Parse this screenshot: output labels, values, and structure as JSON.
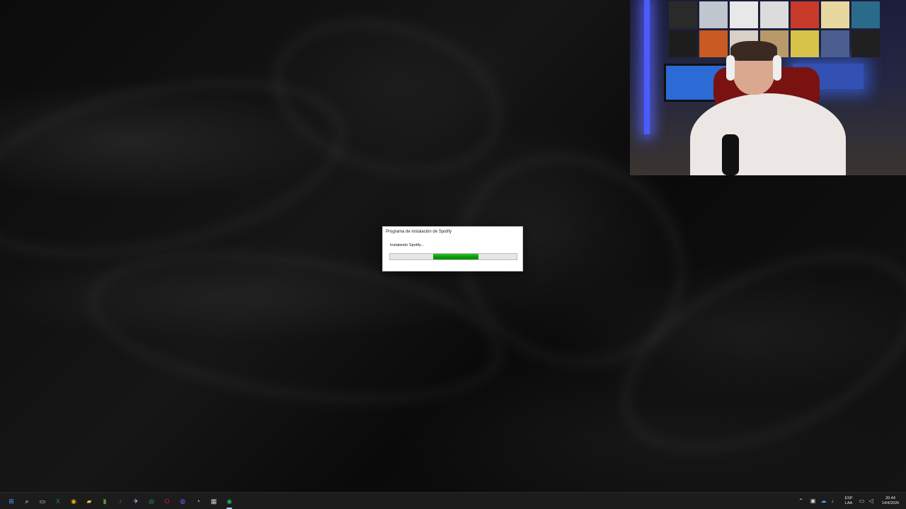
{
  "dialog": {
    "title": "Programa de instalación de Spotify",
    "status": "Instalando Spotify...",
    "progress_start_fraction": 0.34,
    "progress_end_fraction": 0.7
  },
  "taskbar": {
    "icons": [
      {
        "name": "windows-start-icon",
        "glyph": "⊞",
        "color": "#3aa0ff"
      },
      {
        "name": "search-icon",
        "glyph": "⌕",
        "color": "#ffffff"
      },
      {
        "name": "task-view-icon",
        "glyph": "▭",
        "color": "#dddddd"
      },
      {
        "name": "excel-icon",
        "glyph": "X",
        "color": "#1e8e3e"
      },
      {
        "name": "chrome-icon",
        "glyph": "◉",
        "color": "#e8b400"
      },
      {
        "name": "file-explorer-icon",
        "glyph": "▰",
        "color": "#f2c14e"
      },
      {
        "name": "minecraft-icon",
        "glyph": "▮",
        "color": "#5a9a3c"
      },
      {
        "name": "tiktok-icon",
        "glyph": "♪",
        "color": "#e0245e"
      },
      {
        "name": "steam-icon",
        "glyph": "✈",
        "color": "#9fc8ff"
      },
      {
        "name": "spotify-icon",
        "glyph": "◎",
        "color": "#1db954"
      },
      {
        "name": "opera-icon",
        "glyph": "O",
        "color": "#d0112b"
      },
      {
        "name": "discord-icon",
        "glyph": "◍",
        "color": "#5865f2"
      },
      {
        "name": "obs-icon",
        "glyph": "◔",
        "color": "#cccccc"
      },
      {
        "name": "calculator-icon",
        "glyph": "▦",
        "color": "#cccccc"
      },
      {
        "name": "spotify-installer-icon",
        "glyph": "◉",
        "color": "#1db954"
      }
    ],
    "tray": {
      "language_top": "ESP",
      "language_bottom": "LAA",
      "time": "20:44",
      "date": "14/4/2026"
    }
  }
}
